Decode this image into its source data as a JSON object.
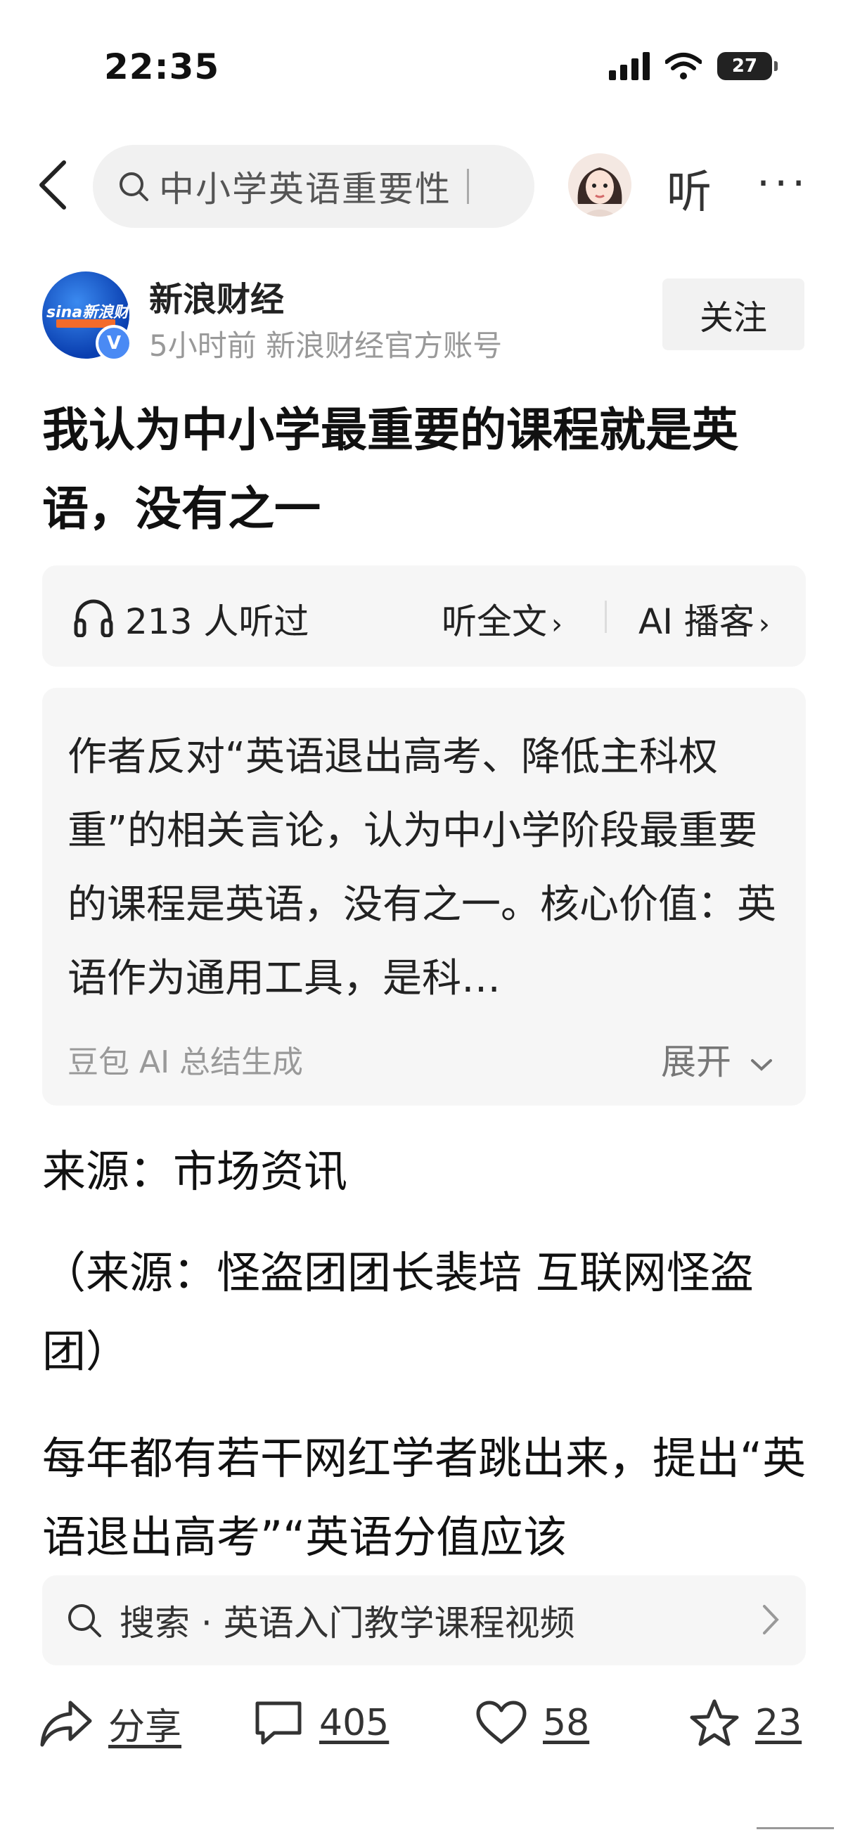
{
  "status_bar": {
    "time": "22:35",
    "battery": "27"
  },
  "nav": {
    "search_query": "中小学英语重要性",
    "listen_label": "听",
    "more_label": "···"
  },
  "author": {
    "logo_text": "sina新浪财经",
    "name": "新浪财经",
    "meta": "5小时前  新浪财经官方账号",
    "follow_label": "关注",
    "verified_mark": "V"
  },
  "article": {
    "title": "我认为中小学最重要的课程就是英语，没有之一",
    "listen_count": "213 人听过",
    "listen_full": "听全文",
    "ai_podcast": "AI 播客",
    "summary": "作者反对“英语退出高考、降低主科权重”的相关言论，认为中小学阶段最重要的课程是英语，没有之一。核心价值：英语作为通用工具，是科…",
    "summary_source": "豆包 AI 总结生成",
    "expand_label": "展开",
    "paragraphs": [
      "来源：市场资讯",
      "（来源：怪盗团团长裴培 互联网怪盗团）",
      "每年都有若干网红学者跳出来，提出“英语退出高考”“英语分值应该"
    ]
  },
  "related_search": {
    "label": "搜索 · 英语入门教学课程视频"
  },
  "actions": {
    "share_label": "分享",
    "comments": "405",
    "likes": "58",
    "favorites": "23"
  }
}
